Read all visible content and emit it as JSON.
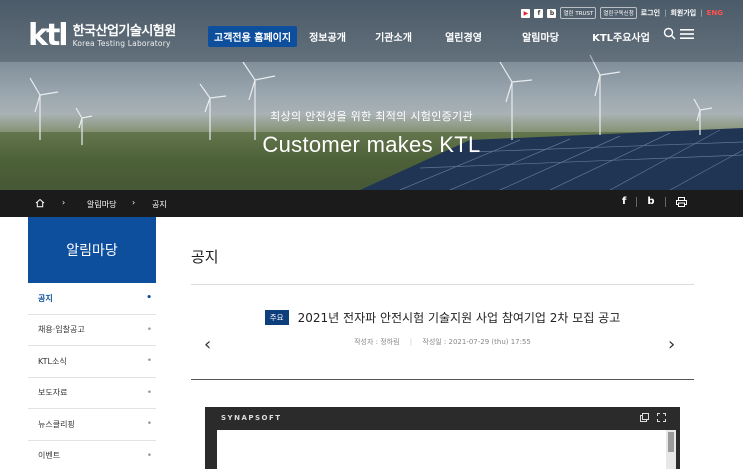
{
  "header": {
    "logo_mark": "ktl",
    "logo_ko": "한국산업기술시험원",
    "logo_en": "Korea Testing Laboratory",
    "util": {
      "badge1": "열린 TRUST",
      "badge2": "열린구독신청",
      "login": "로그인",
      "join": "회원가입",
      "lang": "ENG"
    },
    "gnb": {
      "customer": "고객전용 홈페이지",
      "items": [
        "정보공개",
        "기관소개",
        "열린경영",
        "알림마당",
        "KTL주요사업"
      ]
    }
  },
  "hero": {
    "subtitle": "최상의 안전성을 위한 최적의 시험인증기관",
    "title": "Customer makes KTL"
  },
  "breadcrumb": {
    "level1": "알림마당",
    "level2": "공지"
  },
  "sidebar": {
    "title": "알림마당",
    "items": [
      {
        "label": "공지",
        "active": true
      },
      {
        "label": "채용·입찰공고",
        "active": false
      },
      {
        "label": "KTL소식",
        "active": false
      },
      {
        "label": "보도자료",
        "active": false
      },
      {
        "label": "뉴스클리핑",
        "active": false
      },
      {
        "label": "이벤트",
        "active": false
      }
    ]
  },
  "content": {
    "page_title": "공지",
    "post": {
      "tag": "주요",
      "subject": "2021년 전자파 안전시험 기술지원 사업 참여기업 2차 모집 공고",
      "author": "작성자 : 정하림",
      "date": "작성일 : 2021-07-29 (thu) 17:55"
    },
    "viewer": {
      "brand": "SYNAPSOFT"
    }
  },
  "colors": {
    "brand_blue": "#0d4f9c",
    "logo_red": "#e4262c",
    "breadcrumb_bg": "#1b1b1b"
  }
}
